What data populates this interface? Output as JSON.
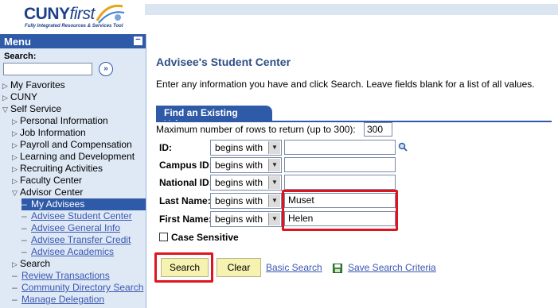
{
  "header": {
    "logo_main": "CUNY",
    "logo_first": "first",
    "logo_tagline": "Fully Integrated Resources & Services Tool"
  },
  "menu": {
    "title": "Menu",
    "collapse": "−",
    "search_label": "Search:",
    "search_value": "",
    "go_symbol": "»",
    "items": [
      {
        "label": "My Favorites",
        "level": 1,
        "type": "folder-closed"
      },
      {
        "label": "CUNY",
        "level": 1,
        "type": "folder-closed"
      },
      {
        "label": "Self Service",
        "level": 1,
        "type": "folder-open"
      },
      {
        "label": "Personal Information",
        "level": 2,
        "type": "folder-closed"
      },
      {
        "label": "Job Information",
        "level": 2,
        "type": "folder-closed"
      },
      {
        "label": "Payroll and Compensation",
        "level": 2,
        "type": "folder-closed"
      },
      {
        "label": "Learning and Development",
        "level": 2,
        "type": "folder-closed"
      },
      {
        "label": "Recruiting Activities",
        "level": 2,
        "type": "folder-closed"
      },
      {
        "label": "Faculty Center",
        "level": 2,
        "type": "folder-closed"
      },
      {
        "label": "Advisor Center",
        "level": 2,
        "type": "folder-open"
      },
      {
        "label": "My Advisees",
        "level": 3,
        "type": "selected"
      },
      {
        "label": "Advisee Student Center",
        "level": 3,
        "type": "link"
      },
      {
        "label": "Advisee General Info",
        "level": 3,
        "type": "link"
      },
      {
        "label": "Advisee Transfer Credit",
        "level": 3,
        "type": "link"
      },
      {
        "label": "Advisee Academics",
        "level": 3,
        "type": "link"
      },
      {
        "label": "Search",
        "level": 2,
        "type": "folder-closed"
      },
      {
        "label": "Review Transactions",
        "level": 2,
        "type": "link"
      },
      {
        "label": "Community Directory Search",
        "level": 2,
        "type": "link"
      },
      {
        "label": "Manage Delegation",
        "level": 2,
        "type": "link"
      }
    ]
  },
  "main": {
    "title": "Advisee's Student Center",
    "instructions": "Enter any information you have and click Search. Leave fields blank for a list of all values.",
    "tab_label": "Find an Existing Value",
    "max_rows_label": "Maximum number of rows to return (up to 300):",
    "max_rows_value": "300",
    "fields": [
      {
        "label": "ID:",
        "operator": "begins with",
        "value": ""
      },
      {
        "label": "Campus ID:",
        "operator": "begins with",
        "value": ""
      },
      {
        "label": "National ID:",
        "operator": "begins with",
        "value": ""
      },
      {
        "label": "Last Name:",
        "operator": "begins with",
        "value": "Muset"
      },
      {
        "label": "First Name:",
        "operator": "begins with",
        "value": "Helen"
      }
    ],
    "case_sensitive_label": "Case Sensitive",
    "search_button": "Search",
    "clear_button": "Clear",
    "basic_search_link": "Basic Search",
    "save_criteria_link": "Save Search Criteria"
  },
  "colors": {
    "menu_header": "#2e5aa7",
    "menu_bg": "#dfe9f6",
    "highlight": "#e0141e",
    "button_bg": "#f6f2b0",
    "link": "#3a57b0"
  }
}
